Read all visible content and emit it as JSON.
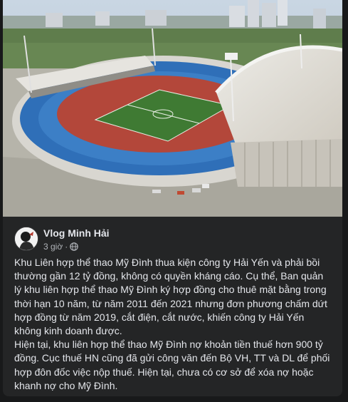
{
  "post": {
    "author": "Vlog Minh Hải",
    "time": "3 giờ",
    "dot": "·",
    "privacy_icon": "globe-icon",
    "paragraphs": [
      "Khu Liên hợp thể thao Mỹ Đình thua kiện công ty Hải Yến và phải bồi thường gần 12 tỷ đồng, không có quyền kháng cáo. Cụ thể, Ban quản lý khu liên hợp thể thao Mỹ Đình ký hợp đồng cho thuê mặt bằng trong thời hạn 10 năm, từ năm 2011 đến 2021 nhưng đơn phương chấm dứt hợp đồng từ năm 2019, cắt điện, cắt nước, khiến công ty Hải Yến không kinh doanh được.",
      "Hiện tại, khu liên hợp thể thao Mỹ Đình nợ khoản tiền thuế hơn 900 tỷ đồng. Cục thuế HN cũng đã gửi công văn đến Bộ  VH, TT và DL để phối hợp đôn đốc việc nộp thuế. Hiện tại, chưa có cơ sở để xóa nợ hoặc khanh nợ cho Mỹ Đình."
    ]
  },
  "colors": {
    "background": "#18191a",
    "card": "#242526",
    "text": "#e4e6eb",
    "secondary_text": "#b0b3b8",
    "track": "#b3473a",
    "pitch": "#3f7a33",
    "seats": "#2f6fb8"
  }
}
